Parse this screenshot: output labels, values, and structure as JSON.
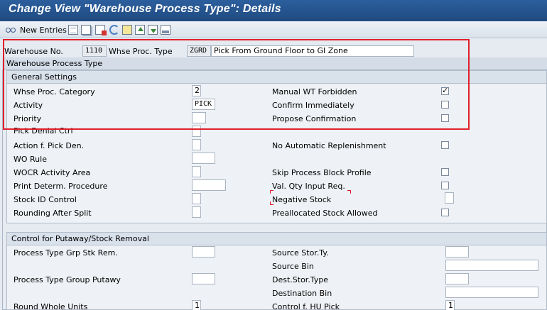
{
  "title": "Change View \"Warehouse Process Type\": Details",
  "toolbar": {
    "new_entries": "New Entries",
    "icons": [
      "glasses-icon",
      "details-icon",
      "copy-icon",
      "delete-icon",
      "undo-icon",
      "select-icon",
      "previous-entry-icon",
      "next-entry-icon",
      "print-icon"
    ]
  },
  "header": {
    "warehouse_label": "Warehouse No.",
    "warehouse_value": "1110",
    "proc_type_label": "Whse Proc. Type",
    "proc_type_value": "ZGRD",
    "proc_type_desc": "Pick From Ground Floor to GI Zone"
  },
  "section_title": "Warehouse Process Type",
  "general": {
    "title": "General Settings",
    "left": [
      {
        "label": "Whse Proc. Category",
        "value": "2"
      },
      {
        "label": "Activity",
        "value": "PICK"
      },
      {
        "label": "Priority",
        "value": ""
      },
      {
        "label": "Pick Denial Ctrl",
        "value": ""
      },
      {
        "label": "Action f. Pick Den.",
        "value": ""
      },
      {
        "label": "WO Rule",
        "value": ""
      },
      {
        "label": "WOCR Activity Area",
        "value": ""
      },
      {
        "label": "Print Determ. Procedure",
        "value": ""
      },
      {
        "label": "Stock ID Control",
        "value": ""
      },
      {
        "label": "Rounding After Split",
        "value": ""
      }
    ],
    "right": [
      {
        "label": "Manual WT Forbidden",
        "checked": true
      },
      {
        "label": "Confirm Immediately",
        "checked": false
      },
      {
        "label": "Propose Confirmation",
        "checked": false
      },
      {
        "label": "No Automatic Replenishment",
        "checked": false
      },
      {
        "label": "Skip Process Block Profile",
        "checked": false
      },
      {
        "label": "Val. Qty Input Req.",
        "checked": false
      },
      {
        "label": "Negative Stock",
        "value": ""
      },
      {
        "label": "Preallocated Stock Allowed",
        "checked": false
      }
    ]
  },
  "putaway": {
    "title": "Control for Putaway/Stock Removal",
    "left": [
      {
        "label": "Process Type Grp Stk Rem.",
        "value": ""
      },
      {
        "label": "Process Type Group Putawy",
        "value": ""
      },
      {
        "label": "Round Whole Units",
        "value": "1"
      }
    ],
    "right": [
      {
        "label": "Source Stor.Ty.",
        "value": ""
      },
      {
        "label": "Source Bin",
        "value": ""
      },
      {
        "label": "Dest.Stor.Type",
        "value": ""
      },
      {
        "label": "Destination Bin",
        "value": ""
      },
      {
        "label": "Control f. HU Pick",
        "value": "1"
      }
    ]
  },
  "colors": {
    "title_bar": "#1f4a80",
    "highlight": "#e0202a"
  }
}
